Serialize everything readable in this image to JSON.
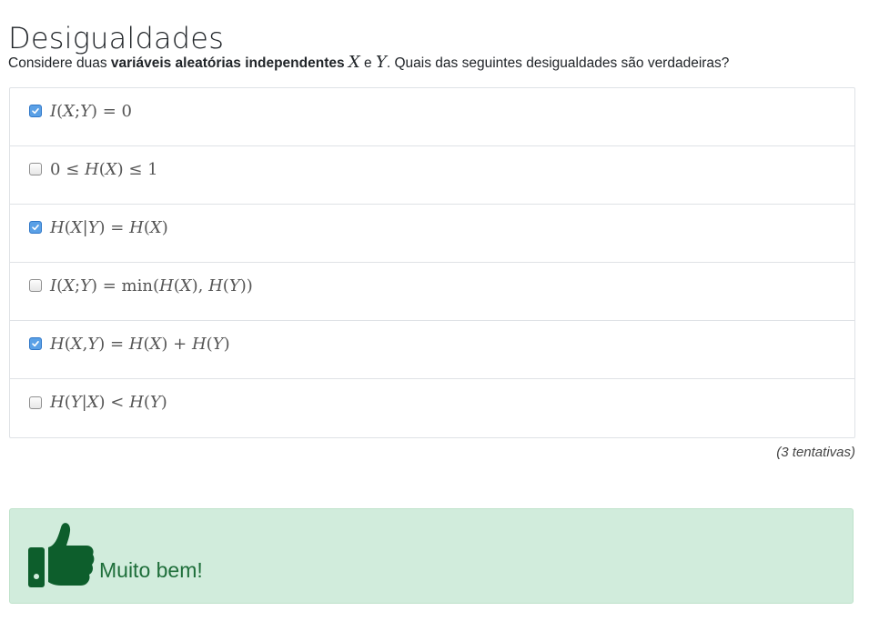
{
  "page": {
    "title": "Desigualdades"
  },
  "question": {
    "prefix": "Considere duas ",
    "bold": "variáveis aleatórias independentes",
    "var_x": "X",
    "conj": " e ",
    "var_y": "Y",
    "suffix": ". Quais das seguintes desigualdades são verdadeiras?"
  },
  "options": [
    {
      "formula": "I(X;Y) = 0",
      "checked": true
    },
    {
      "formula": "0 ≤ H(X) ≤ 1",
      "checked": false
    },
    {
      "formula": "H(X|Y) = H(X)",
      "checked": true
    },
    {
      "formula": "I(X;Y) = min(H(X), H(Y))",
      "checked": false
    },
    {
      "formula": "H(X,Y) = H(X) + H(Y)",
      "checked": true
    },
    {
      "formula": "H(Y|X) < H(Y)",
      "checked": false
    }
  ],
  "attempts": "(3 tentativas)",
  "feedback": {
    "message": "Muito bem!",
    "icon": "thumbs-up-icon"
  },
  "colors": {
    "success_bg": "#d1ecdc",
    "success_text": "#1e6e3a",
    "checkbox_checked": "#5aa0e6"
  }
}
